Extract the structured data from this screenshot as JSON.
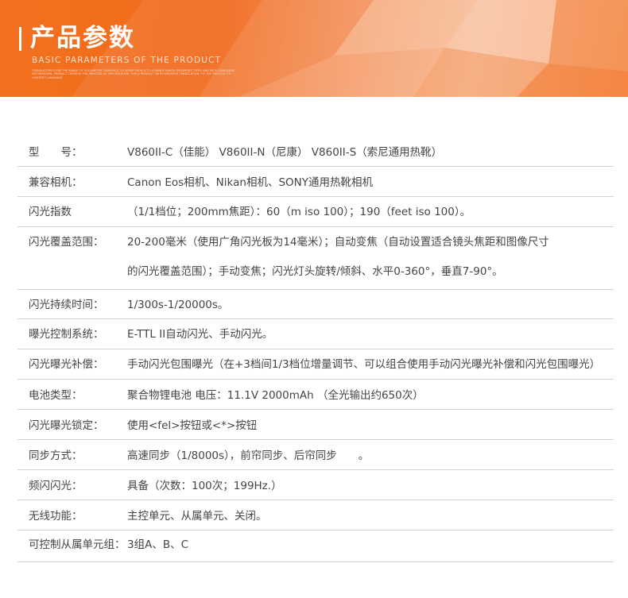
{
  "banner": {
    "title": "产品参数",
    "subtitle": "BASIC PARAMETERS OF THE PRODUCT",
    "fine_print": "TRANSLATION FROM THE RANGE OF VOLUMETRIC GRAPHICS, TO WORK FROM A TO A RANGE WHICH DIFFERENT TYPES AND WITH LANGUAGE INFORMATION, PRODUCT ITEMS IN THE PROCESS OF SPECIFICATION, FOR A PRODUCT WITH SPECIFICS TRANSLATION, TO THE PROCESS TO CONTENT LANGUAGE"
  },
  "specs": [
    {
      "label": "型　　号：",
      "value": "V860II-C（佳能） V860II-N（尼康） V860II-S（索尼通用热靴）"
    },
    {
      "label": "兼容相机：",
      "value": " Canon Eos相机、Nikan相机、SONY通用热靴相机"
    },
    {
      "label": "闪光指数",
      "value": "（1/1档位；200mm焦距）：60（m iso 100）；190（feet iso 100）。"
    },
    {
      "label": "闪光覆盖范围：",
      "value": "20-200毫米（使用广角闪光板为14毫米）；自动变焦（自动设置适合镜头焦距和图像尺寸",
      "value2": "的闪光覆盖范围）；手动变焦；闪光灯头旋转/倾斜、水平0-360°，垂直7-90°。"
    },
    {
      "label": "闪光持续时间：",
      "value": "1/300s-1/20000s。"
    },
    {
      "label": "曝光控制系统：",
      "value": " E-TTL II自动闪光、手动闪光。"
    },
    {
      "label": "闪光曝光补偿：",
      "value": " 手动闪光包围曝光（在+3档间1/3档位增量调节、可以组合使用手动闪光曝光补偿和闪光包围曝光）"
    },
    {
      "label": "电池类型：",
      "value": "聚合物锂电池  电压：11.1V 2000mAh （全光输出约650次）"
    },
    {
      "label": "闪光曝光锁定：",
      "value": "使用<fel>按钮或<*>按钮"
    },
    {
      "label": "同步方式：",
      "value": "高速同步（1/8000s），前帘同步、后帘同步　　。"
    },
    {
      "label": "频闪闪光：",
      "value": "具备（次数：100次；199Hz.）"
    },
    {
      "label": "无线功能：",
      "value": "主控单元、从属单元、关闭。"
    },
    {
      "label": "可控制从属单元组：",
      "value": "3组A、B、C"
    }
  ]
}
